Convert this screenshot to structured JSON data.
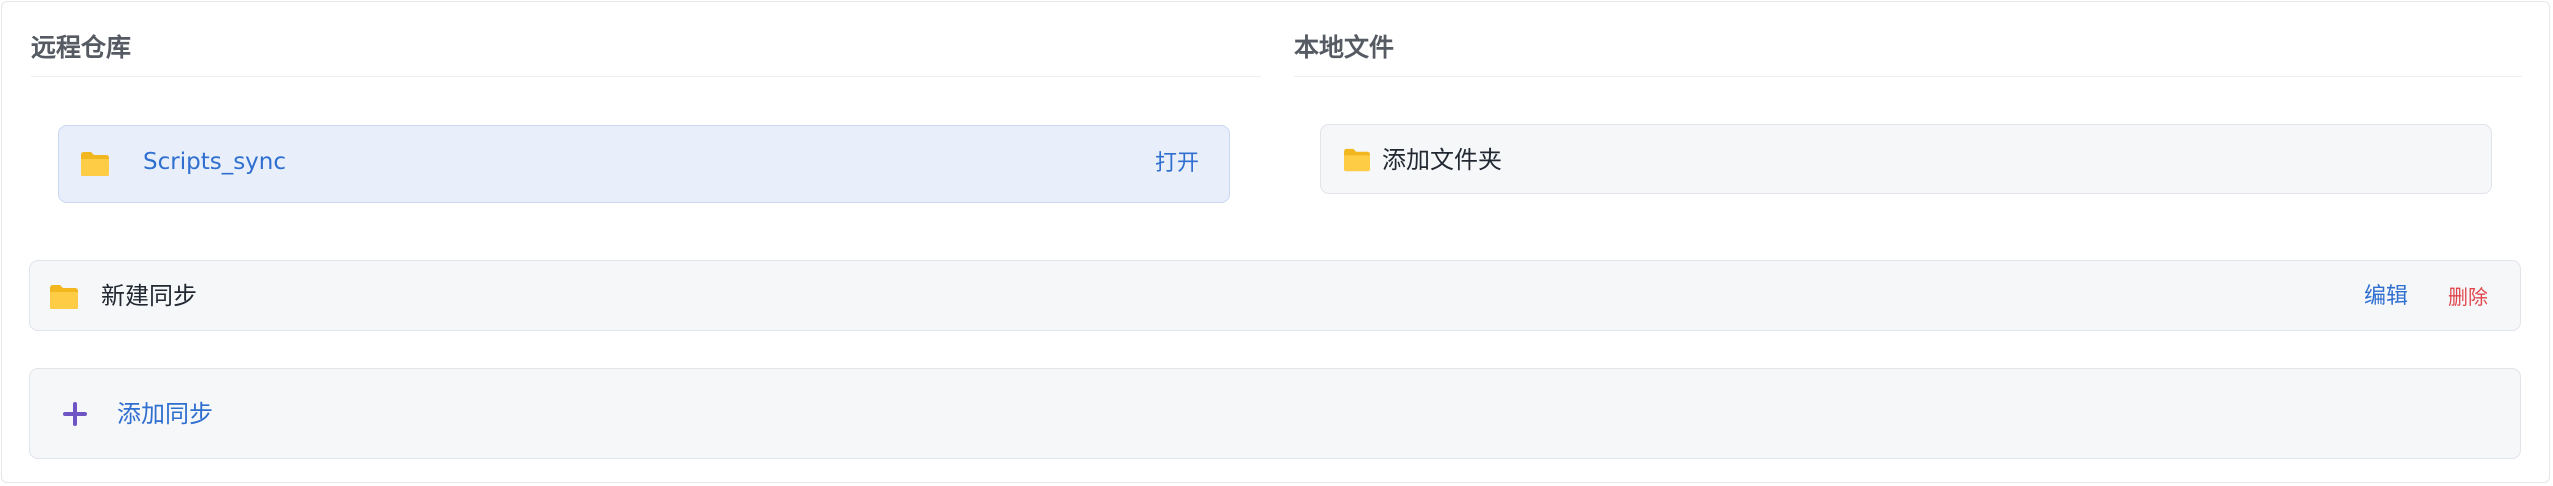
{
  "remote": {
    "title": "远程仓库",
    "repo": {
      "icon": "folder-icon",
      "name": "Scripts_sync",
      "open_label": "打开"
    }
  },
  "local": {
    "title": "本地文件",
    "add_folder_label": "添加文件夹",
    "icon": "folder-icon"
  },
  "sync": {
    "icon": "folder-icon",
    "name": "新建同步",
    "edit_label": "编辑",
    "delete_label": "删除"
  },
  "add_sync": {
    "icon": "plus-icon",
    "label": "添加同步"
  },
  "colors": {
    "accent_blue": "#2f6fd0",
    "delete_red": "#e0474c",
    "plus_purple": "#6f55c4",
    "folder_yellow": "#ffc83d",
    "selected_card_bg": "#e8effb"
  }
}
